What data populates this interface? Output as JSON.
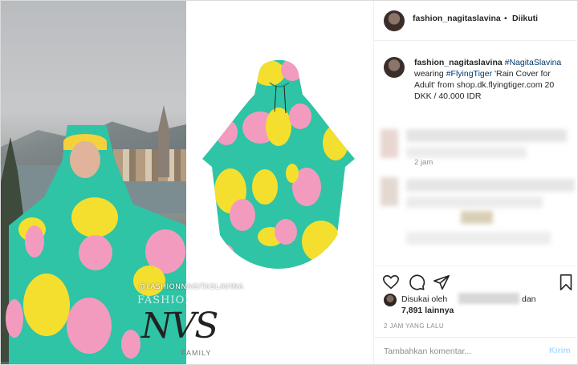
{
  "colors": {
    "poncho_green": "#2ec4a5",
    "dot_pink": "#f39bbf",
    "dot_yellow": "#f5df2e",
    "link_blue": "#00376b",
    "send_disabled": "#b3dbff"
  },
  "photo": {
    "watermark_handle": "@FASHIONNAGITASLAVINA",
    "watermark_name": "FASHIONNAGITA SLAVINA",
    "logo_letters": "NVS",
    "logo_subtitle": "FAMILY"
  },
  "header": {
    "username": "fashion_nagitaslavina",
    "separator": "•",
    "follow_status": "Diikuti"
  },
  "caption": {
    "username": "fashion_nagitaslavina",
    "hashtag_person": "#NagitaSlavina",
    "text_1": "wearing",
    "hashtag_brand": "#FlyingTiger",
    "text_2": "'Rain Cover for Adult' from shop.dk.flyingtiger.com 20 DKK / 40.000 IDR",
    "time": "2 jam"
  },
  "likes": {
    "prefix": "Disukai oleh",
    "suffix": "dan",
    "count": "7,891 lainnya"
  },
  "post_age": "2 JAM YANG LALU",
  "comment": {
    "placeholder": "Tambahkan komentar...",
    "send_label": "Kirim"
  },
  "icons": [
    "heart-icon",
    "comment-icon",
    "share-icon",
    "bookmark-icon"
  ]
}
